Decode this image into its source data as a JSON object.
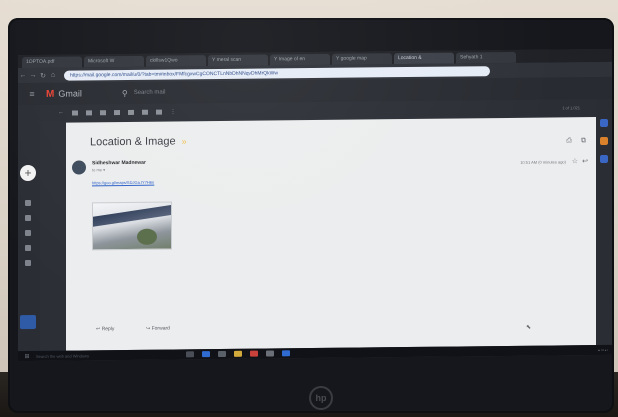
{
  "browser": {
    "tabs": [
      {
        "label": "1OPTOA.pdf"
      },
      {
        "label": "Microsoft W"
      },
      {
        "label": "ckillsw1Qwo"
      },
      {
        "label": "Y meral scan"
      },
      {
        "label": "Y Image of en"
      },
      {
        "label": "Y google map"
      },
      {
        "label": "Location &"
      },
      {
        "label": "Sehyath 1"
      }
    ],
    "url": "https://mail.google.com/mail/u/0/?tab=tm#inbox/FMfcgxwCgCONCTLnNbDhNNqvDhMrQkWw"
  },
  "gmail": {
    "app_name": "Gmail",
    "search_placeholder": "Search mail",
    "pager_text": "1 of 1,021"
  },
  "email": {
    "subject": "Location & Image",
    "sender": "Sidheshwar Madnewar",
    "to": "to me ▾",
    "timestamp": "10:51 AM (0 minutes ago)",
    "link_text": "https://goo.gl/maps/SDJGa.tY7H6n",
    "reply_label": "Reply",
    "forward_label": "Forward"
  },
  "taskbar": {
    "search_placeholder": "Search the web and Windows"
  },
  "colors": {
    "gmail_red": "#ea4335",
    "label_yellow": "#f3c14f",
    "link_blue": "#2c62c9",
    "omnibox_bg": "#e6ecf6"
  }
}
